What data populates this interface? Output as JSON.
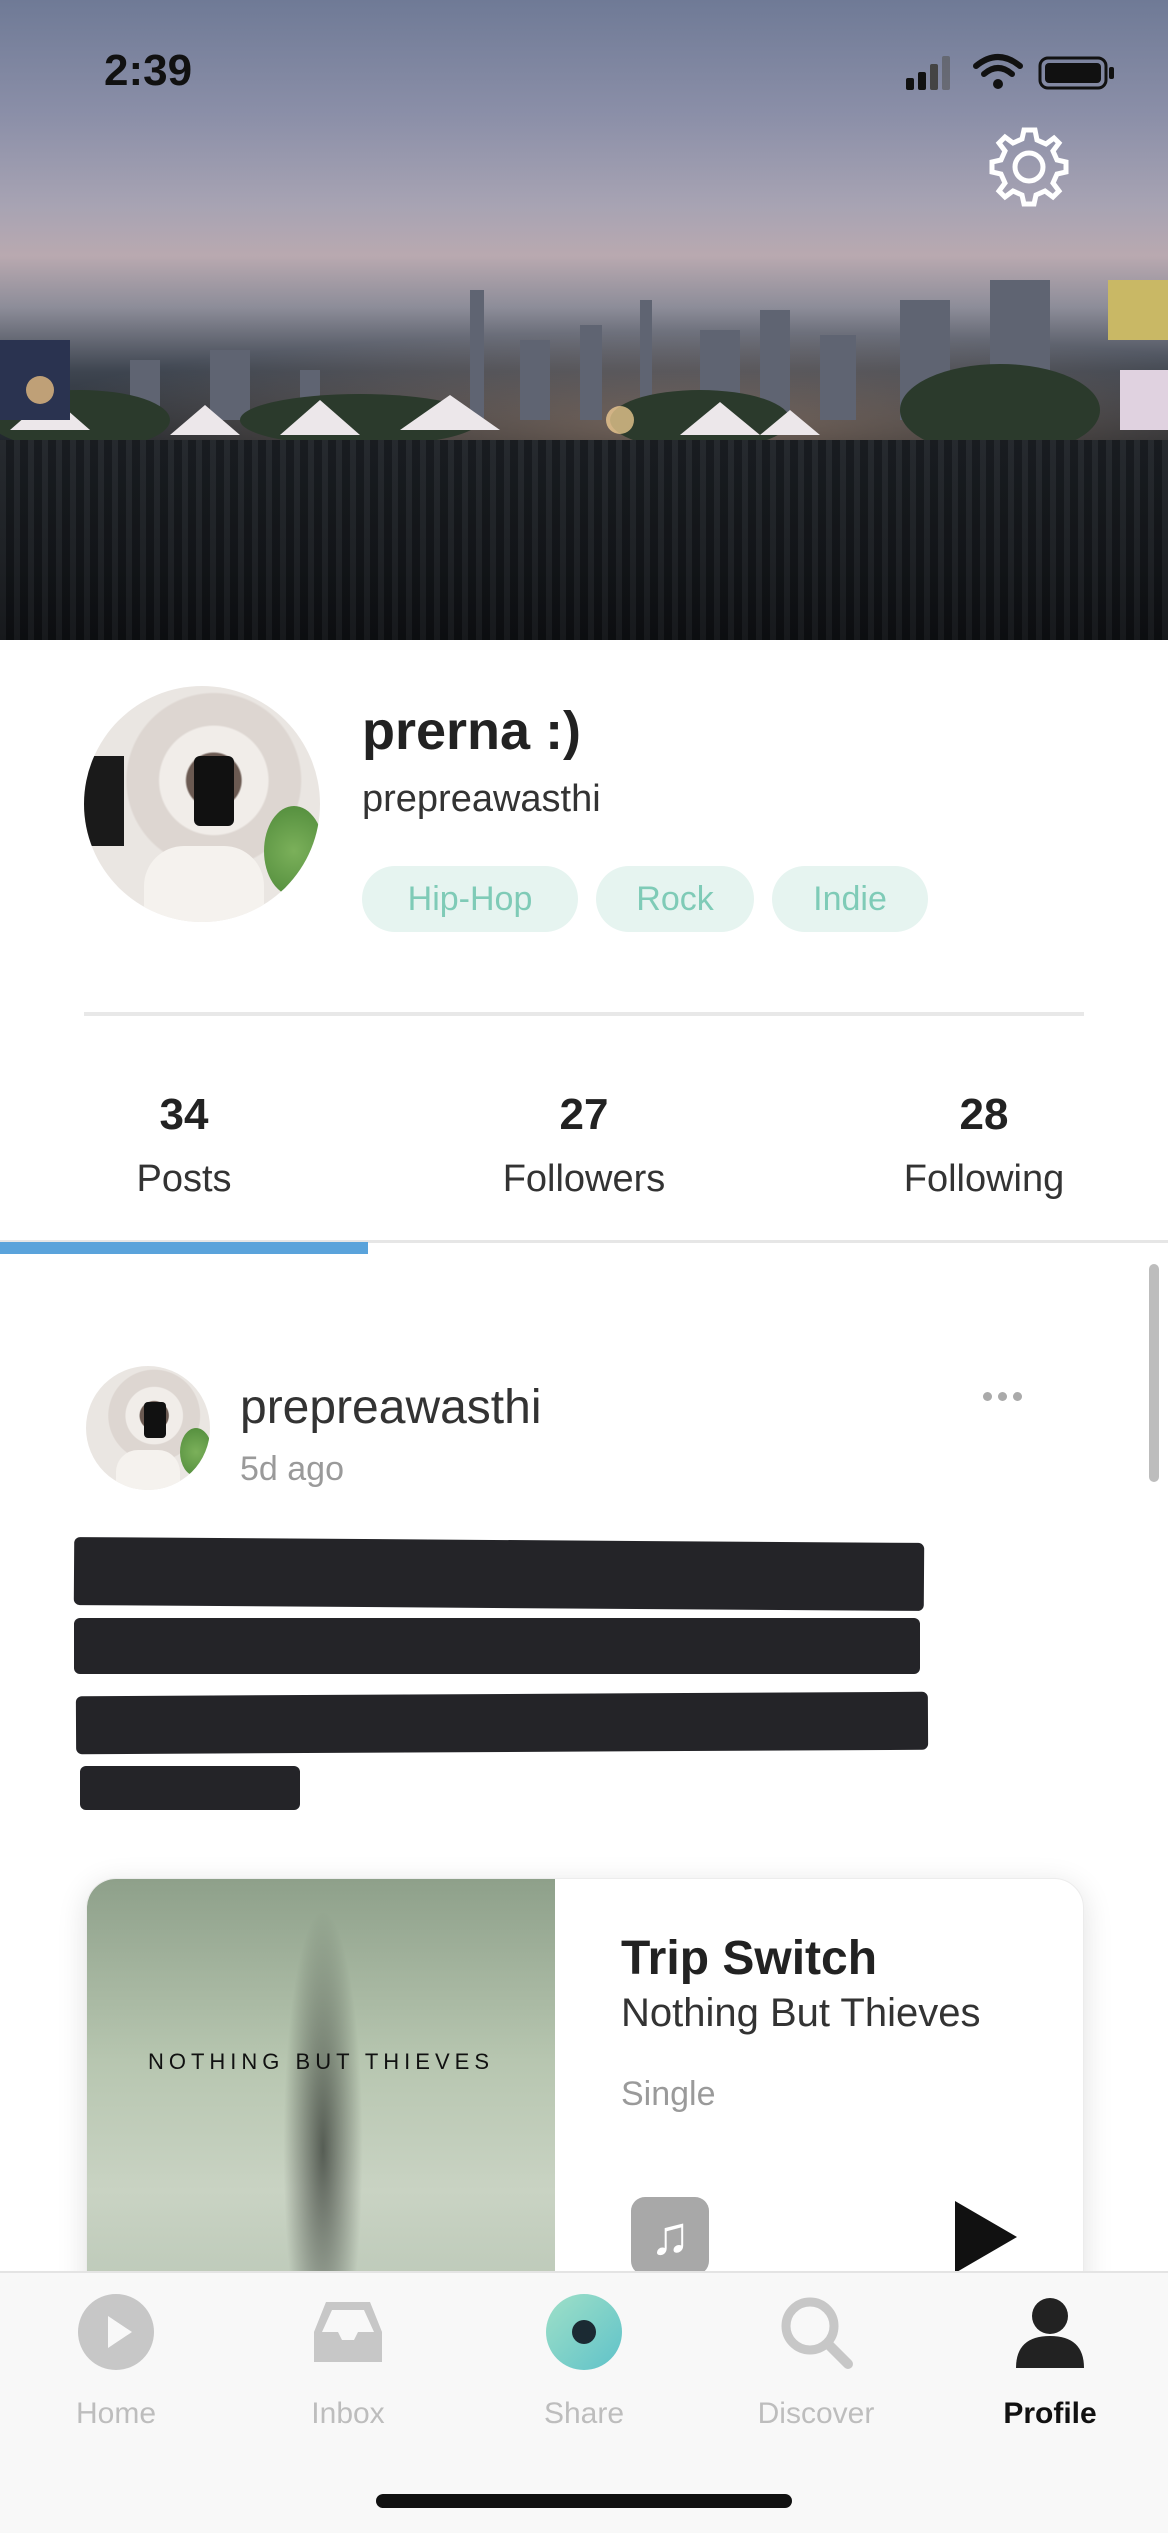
{
  "status_bar": {
    "time": "2:39"
  },
  "profile": {
    "display_name": "prerna :)",
    "username": "prepreawasthi",
    "genres": [
      "Hip-Hop",
      "Rock",
      "Indie"
    ],
    "stats": [
      {
        "value": "34",
        "label": "Posts"
      },
      {
        "value": "27",
        "label": "Followers"
      },
      {
        "value": "28",
        "label": "Following"
      }
    ],
    "active_tab": "Posts"
  },
  "post": {
    "username": "prepreawasthi",
    "time_ago": "5d ago",
    "music": {
      "cover_text": "NOTHING BUT THIEVES",
      "title": "Trip Switch",
      "artist": "Nothing But Thieves",
      "type": "Single"
    }
  },
  "nav": {
    "items": [
      {
        "label": "Home",
        "icon": "play-circle-icon"
      },
      {
        "label": "Inbox",
        "icon": "inbox-tray-icon"
      },
      {
        "label": "Share",
        "icon": "share-record-icon"
      },
      {
        "label": "Discover",
        "icon": "search-icon"
      },
      {
        "label": "Profile",
        "icon": "person-icon"
      }
    ],
    "active": "Profile",
    "accent_share": "#7ed3c3"
  },
  "colors": {
    "tab_indicator": "#5aa3db",
    "genre_text": "#7fcbb7",
    "genre_bg": "#e6f4f0"
  }
}
